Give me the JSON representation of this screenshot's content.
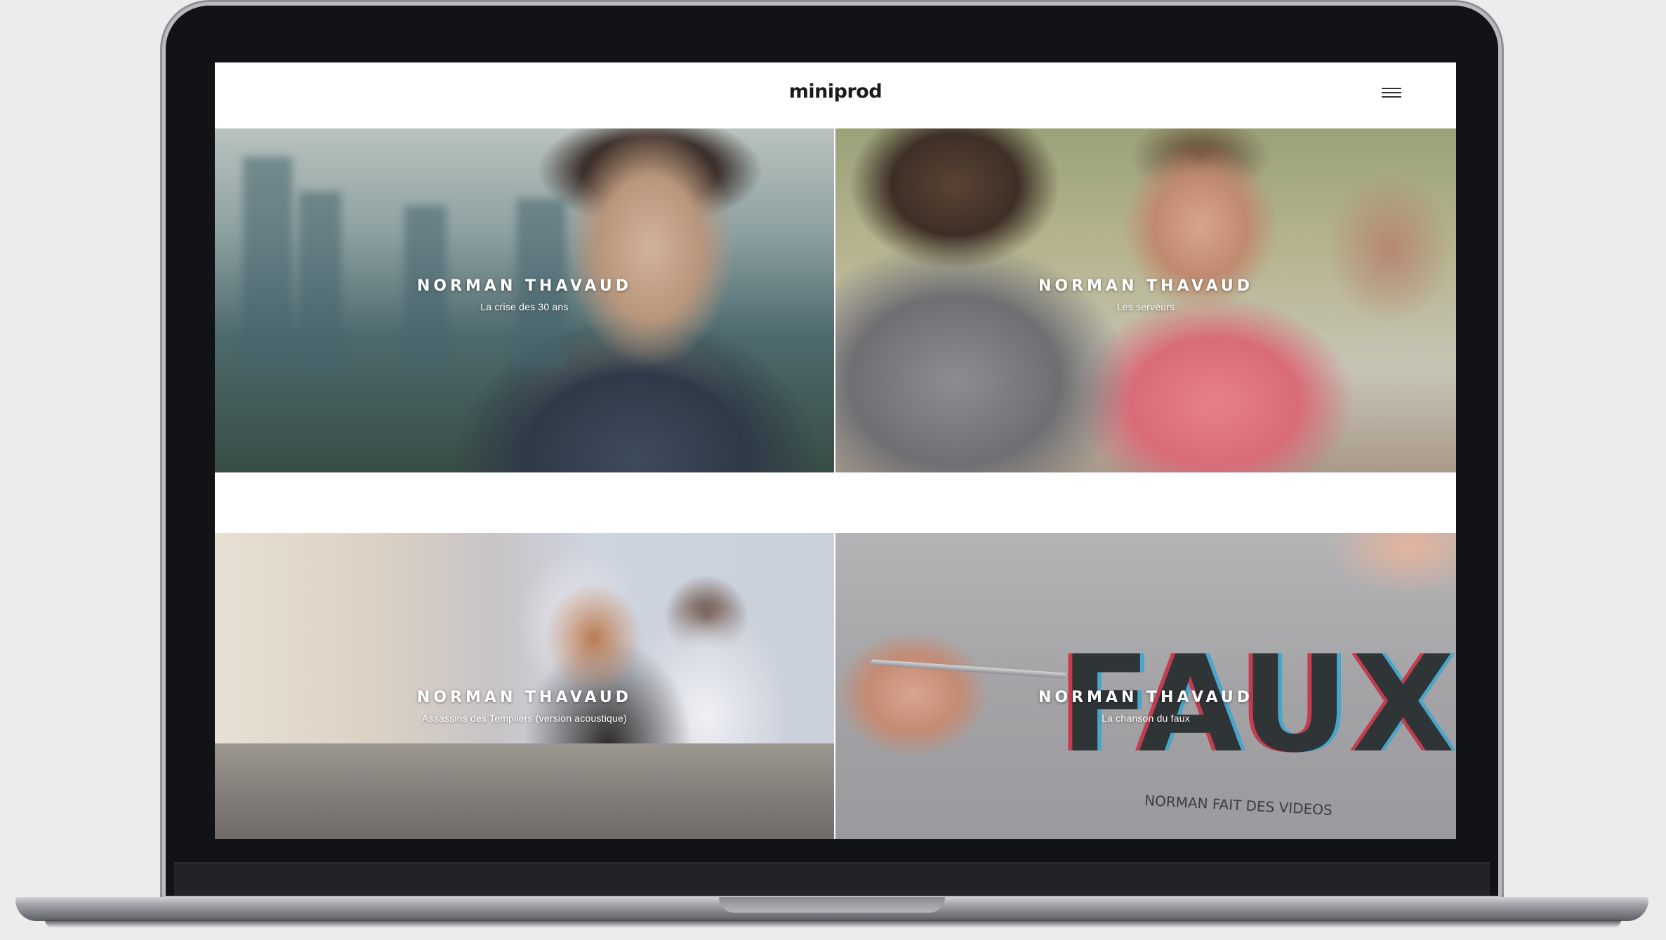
{
  "site": {
    "logo": "miniprod",
    "menu_icon": "hamburger-menu-icon"
  },
  "tiles": [
    {
      "artist": "NORMAN THAVAUD",
      "song": "La crise des 30 ans"
    },
    {
      "artist": "NORMAN THAVAUD",
      "song": "Les serveurs"
    },
    {
      "artist": "NORMAN THAVAUD",
      "song": "Assassins des Templiers (version acoustique)"
    },
    {
      "artist": "NORMAN THAVAUD",
      "song": "La chanson du faux"
    }
  ],
  "image_text": {
    "sweater_word": "FAUX",
    "sweater_tagline": "NORMAN FAIT DES VIDEOS"
  }
}
